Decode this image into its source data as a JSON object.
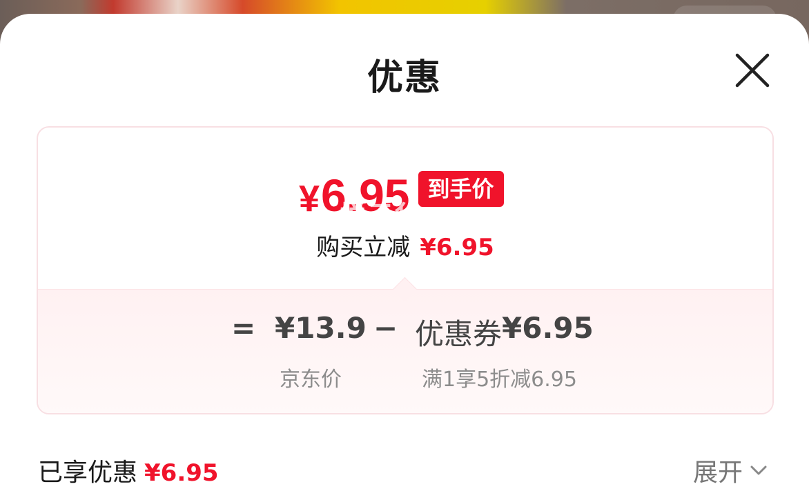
{
  "sheet": {
    "title": "优惠"
  },
  "summary": {
    "price_symbol": "¥",
    "price_value": "6.95",
    "badge": "到手价",
    "watermark": "悦云华",
    "reduce_label": "购买立减",
    "reduce_amount": "¥6.95"
  },
  "breakdown": {
    "equals": "=",
    "base_price": "¥13.9",
    "minus": "−",
    "coupon_label": "优惠券",
    "coupon_amount": "¥6.95",
    "base_caption": "京东价",
    "coupon_caption": "满1享5折减6.95"
  },
  "footer": {
    "enjoyed_label": "已享优惠",
    "enjoyed_amount": "¥6.95",
    "expand_label": "展开"
  },
  "colors": {
    "accent": "#f0132b",
    "card_border": "#f8dfe3",
    "card_bottom_bg": "#fff1f2"
  },
  "icons": {
    "close": "close-icon",
    "expand": "chevron-down-icon"
  }
}
